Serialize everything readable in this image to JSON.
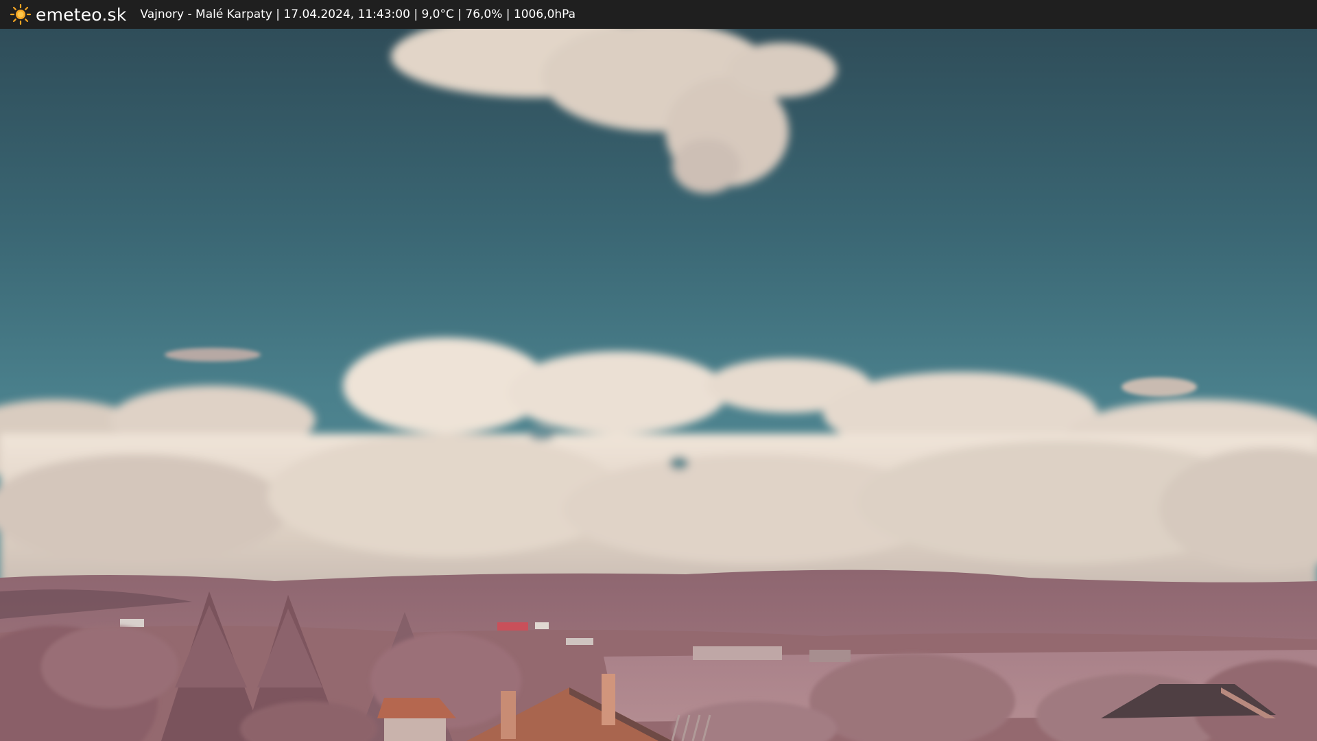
{
  "header": {
    "brand": "emeteo.sk",
    "caption": "Vajnory - Malé Karpaty | 17.04.2024, 11:43:00 | 9,0°C | 76,0% | 1006,0hPa",
    "logo_icon": "sun-icon"
  },
  "colors": {
    "header_background": "#1f1f1f",
    "sun": "#f5a623",
    "sky_top": "#33535f",
    "sky_bottom": "#4e8691",
    "clouds": "#e6d9cc",
    "hills": "#a0767f",
    "vegetation": "#8a5a63",
    "roof": "#b5674f"
  }
}
